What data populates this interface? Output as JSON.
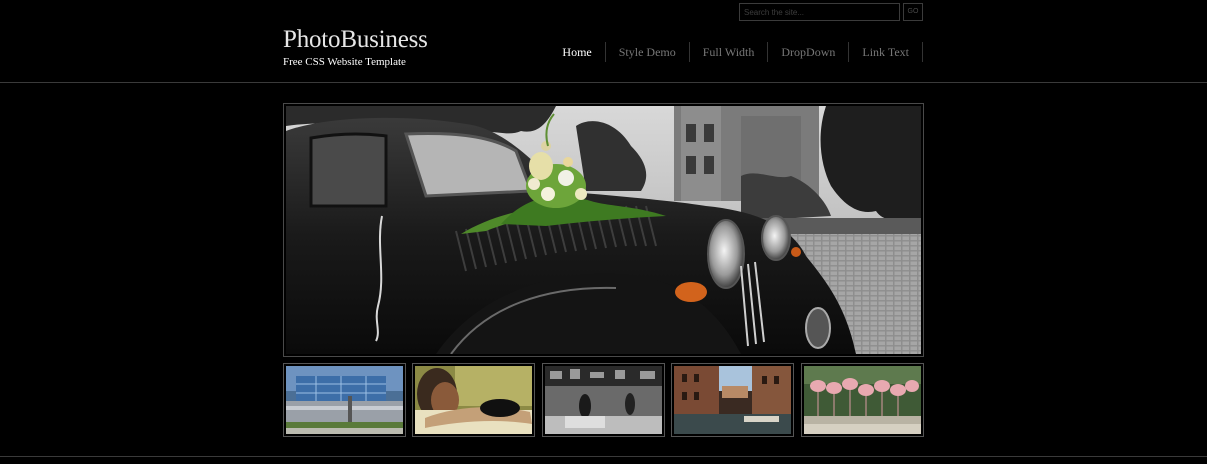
{
  "search": {
    "placeholder": "Search the site...",
    "button_label": "GO"
  },
  "logo": {
    "title": "PhotoBusiness",
    "subtitle": "Free CSS Website Template"
  },
  "nav": {
    "items": [
      {
        "label": "Home",
        "active": true
      },
      {
        "label": "Style Demo"
      },
      {
        "label": "Full Width"
      },
      {
        "label": "DropDown"
      },
      {
        "label": "Link Text"
      }
    ]
  },
  "slider": {
    "main_image": "vintage-wedding-car-photo"
  },
  "thumbnails": [
    {
      "image": "modern-building-photo"
    },
    {
      "image": "person-resting-photo"
    },
    {
      "image": "street-market-photo"
    },
    {
      "image": "venice-canal-photo"
    },
    {
      "image": "flamingos-photo"
    }
  ],
  "colors": {
    "background": "#000000",
    "text_active": "#ffffff",
    "text_muted": "#777777",
    "border": "#4a4a4a"
  }
}
